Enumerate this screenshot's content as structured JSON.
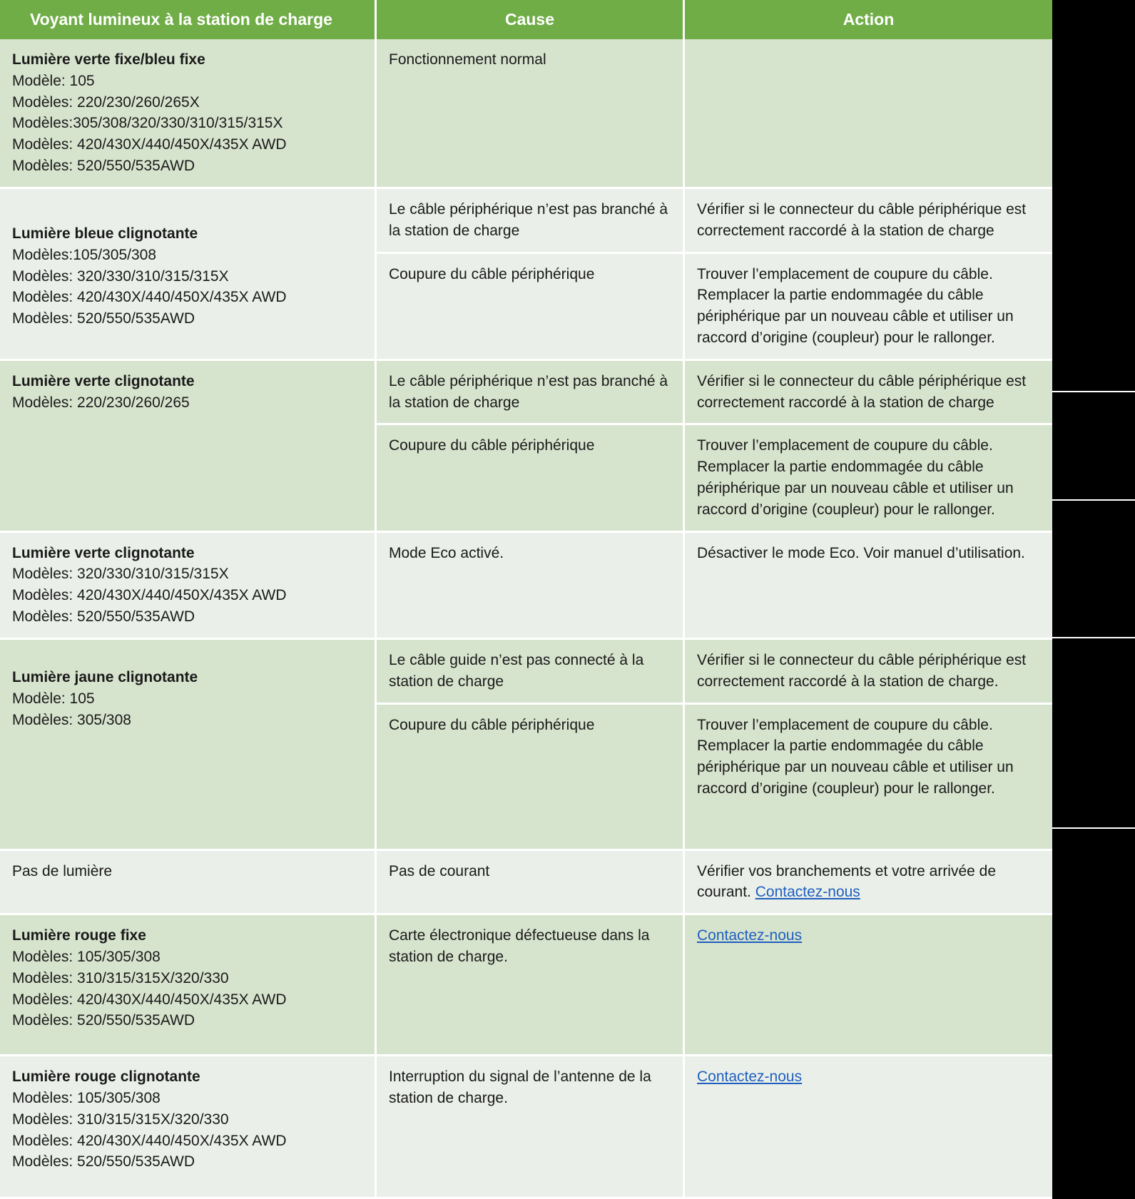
{
  "table": {
    "headers": {
      "indicator": "Voyant lumineux à la station de charge",
      "cause": "Cause",
      "action": "Action"
    },
    "colors": {
      "header_bg": "#70ad47",
      "header_text": "#ffffff",
      "band_dark": "#d6e3cd",
      "band_light": "#eaefe9",
      "link": "#1f5fbf",
      "page_bg": "#000000"
    },
    "link_label": "Contactez-nous",
    "rows": [
      {
        "indicator": {
          "title": "Lumière verte fixe/bleu fixe",
          "models": [
            "Modèle: 105",
            "Modèles: 220/230/260/265X",
            "Modèles:305/308/320/330/310/315/315X",
            "Modèles: 420/430X/440/450X/435X AWD",
            "Modèles: 520/550/535AWD"
          ]
        },
        "subrows": [
          {
            "cause": "Fonctionnement normal",
            "action": ""
          }
        ]
      },
      {
        "indicator": {
          "title": "Lumière bleue clignotante",
          "models": [
            "Modèles:105/305/308",
            "Modèles: 320/330/310/315/315X",
            "Modèles: 420/430X/440/450X/435X AWD",
            "Modèles: 520/550/535AWD"
          ]
        },
        "subrows": [
          {
            "cause": "Le câble périphérique n’est pas branché à la station de charge",
            "action": "Vérifier si le connecteur du câble périphérique est correctement raccordé à la station de charge"
          },
          {
            "cause": "Coupure du câble périphérique",
            "action": "Trouver l’emplacement de coupure du câble. Remplacer la partie endommagée du câble périphérique par un nouveau câble et utiliser un raccord d’origine (coupleur) pour le rallonger."
          }
        ]
      },
      {
        "indicator": {
          "title": "Lumière verte clignotante",
          "models": [
            "Modèles: 220/230/260/265"
          ]
        },
        "subrows": [
          {
            "cause": "Le câble périphérique n’est pas branché à la station de charge",
            "action": "Vérifier si le connecteur du câble périphérique est correctement raccordé à la station de charge"
          },
          {
            "cause": "Coupure du câble périphérique",
            "action": "Trouver l’emplacement de coupure du câble. Remplacer la partie endommagée du câble périphérique par un nouveau câble et utiliser un raccord d’origine (coupleur) pour le rallonger."
          }
        ]
      },
      {
        "indicator": {
          "title": "Lumière verte clignotante",
          "models": [
            "Modèles: 320/330/310/315/315X",
            "Modèles: 420/430X/440/450X/435X AWD",
            "Modèles: 520/550/535AWD"
          ]
        },
        "subrows": [
          {
            "cause": "Mode Eco activé.",
            "action": "Désactiver le mode Eco. Voir manuel d’utilisation."
          }
        ]
      },
      {
        "indicator": {
          "title": "Lumière jaune clignotante",
          "models": [
            "Modèle: 105",
            "Modèles: 305/308"
          ]
        },
        "subrows": [
          {
            "cause": "Le câble guide n’est pas connecté à la station de charge",
            "action": "Vérifier si le connecteur du câble périphérique est correctement raccordé à la station de charge."
          },
          {
            "cause": "Coupure du câble périphérique",
            "action": "Trouver l’emplacement de coupure du câble. Remplacer la partie endommagée du câble périphérique par un nouveau câble et utiliser un raccord d’origine (coupleur) pour le rallonger."
          }
        ]
      },
      {
        "indicator": {
          "title": "",
          "plain": "Pas de lumière",
          "models": []
        },
        "subrows": [
          {
            "cause": "Pas de courant",
            "action_prefix": "Vérifier vos branchements et votre arrivée de courant. ",
            "action_link": "Contactez-nous"
          }
        ]
      },
      {
        "indicator": {
          "title": "Lumière rouge fixe",
          "models": [
            "Modèles: 105/305/308",
            "Modèles: 310/315/315X/320/330",
            "Modèles: 420/430X/440/450X/435X AWD",
            "Modèles: 520/550/535AWD"
          ]
        },
        "subrows": [
          {
            "cause": "Carte électronique défectueuse dans la station de charge.",
            "action_link": "Contactez-nous"
          }
        ]
      },
      {
        "indicator": {
          "title": "Lumière rouge clignotante",
          "models": [
            "Modèles: 105/305/308",
            "Modèles: 310/315/315X/320/330",
            "Modèles: 420/430X/440/450X/435X AWD",
            "Modèles: 520/550/535AWD"
          ]
        },
        "subrows": [
          {
            "cause": "Interruption du signal de l’antenne de la station de charge.",
            "action_link": "Contactez-nous"
          }
        ]
      }
    ]
  }
}
